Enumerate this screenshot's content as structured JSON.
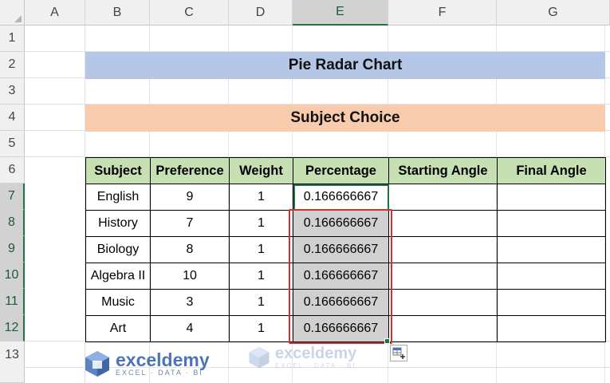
{
  "columns": [
    "A",
    "B",
    "C",
    "D",
    "E",
    "F",
    "G"
  ],
  "rows": [
    "1",
    "2",
    "3",
    "4",
    "5",
    "6",
    "7",
    "8",
    "9",
    "10",
    "11",
    "12",
    "13"
  ],
  "title_banner": "Pie Radar Chart",
  "subtitle_banner": "Subject Choice",
  "table": {
    "headers": [
      "Subject",
      "Preference",
      "Weight",
      "Percentage",
      "Starting Angle",
      "Final Angle"
    ],
    "rows": [
      [
        "English",
        "9",
        "1",
        "0.166666667",
        "",
        ""
      ],
      [
        "History",
        "7",
        "1",
        "0.166666667",
        "",
        ""
      ],
      [
        "Biology",
        "8",
        "1",
        "0.166666667",
        "",
        ""
      ],
      [
        "Algebra II",
        "10",
        "1",
        "0.166666667",
        "",
        ""
      ],
      [
        "Music",
        "3",
        "1",
        "0.166666667",
        "",
        ""
      ],
      [
        "Art",
        "4",
        "1",
        "0.166666667",
        "",
        ""
      ]
    ]
  },
  "watermark": {
    "name": "exceldemy",
    "tagline": "EXCEL · DATA · BI"
  },
  "colors": {
    "banner_blue": "#b4c7e7",
    "banner_orange": "#f8cbad",
    "header_green": "#c6e0b4",
    "selection_gray": "#d0d0d0",
    "excel_green": "#217346",
    "highlight_red": "#d92b2b",
    "brand_blue": "#5b84c4"
  }
}
